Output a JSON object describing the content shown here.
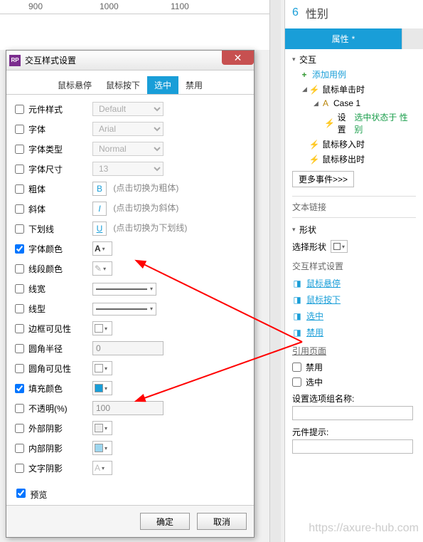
{
  "ruler": {
    "m900": "900",
    "m1000": "1000",
    "m1100": "1100"
  },
  "dialog": {
    "title": "交互样式设置",
    "tabs": {
      "hover": "鼠标悬停",
      "down": "鼠标按下",
      "selected": "选中",
      "disabled": "禁用"
    },
    "rows": {
      "widgetStyle": {
        "label": "元件样式",
        "value": "Default"
      },
      "font": {
        "label": "字体",
        "value": "Arial"
      },
      "fontType": {
        "label": "字体类型",
        "value": "Normal"
      },
      "fontSize": {
        "label": "字体尺寸",
        "value": "13"
      },
      "bold": {
        "label": "粗体",
        "hint": "(点击切换为粗体)",
        "glyph": "B"
      },
      "italic": {
        "label": "斜体",
        "hint": "(点击切换为斜体)",
        "glyph": "I"
      },
      "underline": {
        "label": "下划线",
        "hint": "(点击切换为下划线)",
        "glyph": "U"
      },
      "fontColor": {
        "label": "字体颜色",
        "glyph": "A"
      },
      "lineColor": {
        "label": "线段颜色"
      },
      "lineWidth": {
        "label": "线宽"
      },
      "lineStyle": {
        "label": "线型"
      },
      "borderVis": {
        "label": "边框可见性"
      },
      "cornerRadius": {
        "label": "圆角半径",
        "value": "0"
      },
      "cornerVis": {
        "label": "圆角可见性"
      },
      "fillColor": {
        "label": "填充颜色"
      },
      "opacity": {
        "label": "不透明(%)",
        "value": "100"
      },
      "outerShadow": {
        "label": "外部阴影"
      },
      "innerShadow": {
        "label": "内部阴影"
      },
      "textShadow": {
        "label": "文字阴影",
        "glyph": "A"
      }
    },
    "preview": "预览",
    "ok": "确定",
    "cancel": "取消"
  },
  "panel": {
    "index": "6",
    "name": "性别",
    "tabProps": "属性",
    "section_interaction": "交互",
    "addCase": "添加用例",
    "onClick": "鼠标单击时",
    "case1": "Case 1",
    "action_prefix": "设置 ",
    "action_green": "选中状态于 性别",
    "onMouseEnter": "鼠标移入时",
    "onMouseLeave": "鼠标移出时",
    "moreEvents": "更多事件>>>",
    "textLink": "文本链接",
    "shapeSection": "形状",
    "selectShape": "选择形状",
    "ixStyle": "交互样式设置",
    "ix_hover": "鼠标悬停",
    "ix_down": "鼠标按下",
    "ix_selected": "选中",
    "ix_disabled": "禁用",
    "refPage": "引用页面",
    "chk_disabled": "禁用",
    "chk_selected": "选中",
    "optGroupLabel": "设置选项组名称:",
    "tooltipLabel": "元件提示:"
  },
  "colors": {
    "fill": "#199ed8",
    "inner": "#9dd6ef"
  }
}
